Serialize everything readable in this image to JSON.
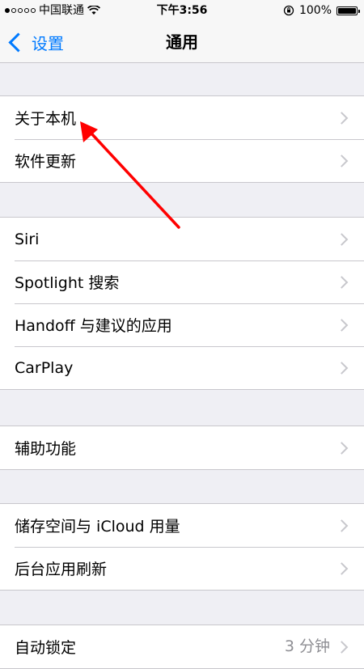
{
  "status_bar": {
    "carrier": "中国联通",
    "time": "下午3:56",
    "battery": "100%",
    "battery_level": 1.0
  },
  "nav": {
    "back_label": "设置",
    "title": "通用"
  },
  "groups": [
    {
      "items": [
        {
          "label": "关于本机"
        },
        {
          "label": "软件更新"
        }
      ]
    },
    {
      "items": [
        {
          "label": "Siri"
        },
        {
          "label": "Spotlight 搜索"
        },
        {
          "label": "Handoff 与建议的应用"
        },
        {
          "label": "CarPlay"
        }
      ]
    },
    {
      "items": [
        {
          "label": "辅助功能"
        }
      ]
    },
    {
      "items": [
        {
          "label": "储存空间与 iCloud 用量"
        },
        {
          "label": "后台应用刷新"
        }
      ]
    },
    {
      "items": [
        {
          "label": "自动锁定",
          "value": "3 分钟"
        }
      ]
    }
  ],
  "annotation_color": "#ff0000"
}
